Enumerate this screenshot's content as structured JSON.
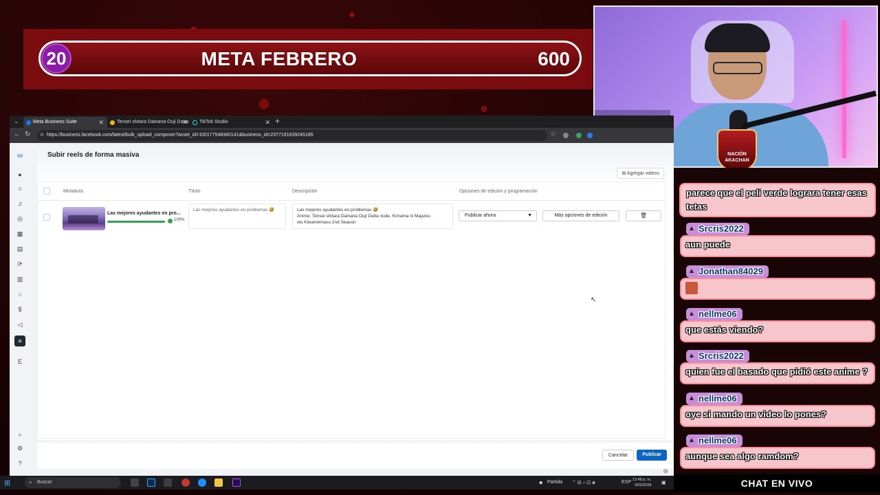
{
  "goal": {
    "current": "20",
    "title": "META FEBRERO",
    "target": "600"
  },
  "badge": {
    "text": "NACIÓN AKACHAN"
  },
  "browser": {
    "tabs": [
      {
        "label": "Meta Business Suite",
        "active": true
      },
      {
        "label": "Tensei shitara Dainana Ouji Datta",
        "active": false
      },
      {
        "label": "TikTok Studio",
        "active": false
      }
    ],
    "url": "https://business.facebook.com/latest/bulk_upload_composer?asset_id=100177548340141&business_id=2377191639245185"
  },
  "app": {
    "page_title": "Subir reels de forma masiva",
    "add_videos": "Agregar videos",
    "columns": {
      "thumbnail": "Miniatura",
      "title": "Título",
      "description": "Descripción",
      "options": "Opciones de edición y programación"
    },
    "row": {
      "title_short": "Las mejores ayudantes en pro...",
      "progress_percent": 100,
      "progress_label": "100%",
      "title_field": "Las mejores ayudantes en problemas 🤣",
      "description_line1": "Las mejores ayudantes en problemas 🤣",
      "description_line2": "Anime: Tensei shitara Dainana Ouji Datta node, Kimama ni Majutsu",
      "description_line3": "wo Kiwamemasu 2nd Season",
      "publish_option": "Publicar ahora",
      "more_options": "Más opciones de edición"
    },
    "footer": {
      "cancel": "Cancelar",
      "publish": "Publicar"
    }
  },
  "taskbar": {
    "search_placeholder": "Buscar",
    "game_label": "Partida",
    "lang": "ESP",
    "time": "12:48 p. m.",
    "date": "3/02/2026"
  },
  "chat": {
    "top_message": "parece que el peli verde lograra tener esas tetas",
    "messages": [
      {
        "user": "Srcris2022",
        "text": "aun puede"
      },
      {
        "user": "Jonathan84029",
        "text": ""
      },
      {
        "user": "nellme06",
        "text": "que estás viendo?"
      },
      {
        "user": "Srcris2022",
        "text": "quien fue el basado que pidió este anime ?"
      },
      {
        "user": "nellme06",
        "text": "oye si mando un video lo pones?"
      },
      {
        "user": "nellme06",
        "text": "aunque sea algo ramdom?"
      }
    ],
    "footer": "CHAT EN VIVO"
  },
  "colors": {
    "banner_red": "#7a0c0f",
    "accent_purple": "#8d1aa8",
    "publish_blue": "#0b65c2",
    "chat_pink": "#f7c6cc"
  }
}
